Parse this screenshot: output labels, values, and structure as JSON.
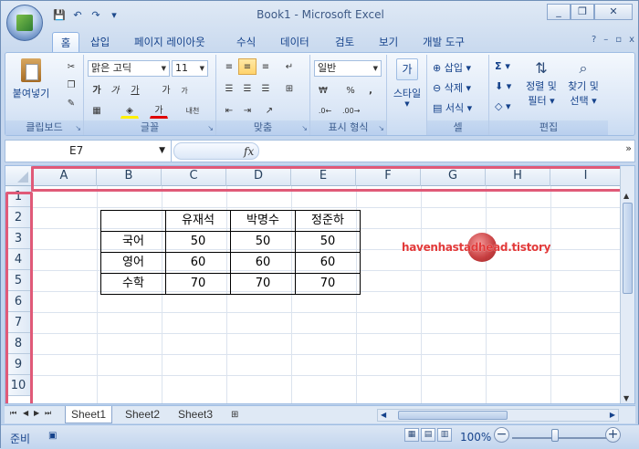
{
  "window": {
    "title": "Book1 - Microsoft Excel",
    "minimize": "_",
    "restore": "❐",
    "close": "✕"
  },
  "qat": {
    "save_icon": "💾",
    "undo_icon": "↶",
    "redo_icon": "↷",
    "more_icon": "▾"
  },
  "tabs": [
    {
      "label": "홈",
      "active": true
    },
    {
      "label": "삽입"
    },
    {
      "label": "페이지 레이아웃"
    },
    {
      "label": "수식"
    },
    {
      "label": "데이터"
    },
    {
      "label": "검토"
    },
    {
      "label": "보기"
    },
    {
      "label": "개발 도구"
    }
  ],
  "tab_icons": {
    "help": "?",
    "minimize": "–",
    "restore": "▫",
    "close": "x"
  },
  "ribbon": {
    "clipboard": {
      "label": "클립보드",
      "paste": "붙여넣기"
    },
    "font": {
      "label": "글꼴",
      "font_name": "맑은 고딕",
      "font_size": "11",
      "bold": "가",
      "italic": "가",
      "underline": "가",
      "grow": "가",
      "shrink": "가",
      "phonetic": "내천",
      "font_color_glyph": "가"
    },
    "alignment": {
      "label": "맞춤"
    },
    "number": {
      "label": "표시 형식",
      "format": "일반",
      "currency": "₩",
      "percent": "%",
      "comma": ","
    },
    "style": {
      "label": "스타일"
    },
    "cells": {
      "label": "셀",
      "insert": "삽입",
      "delete": "삭제",
      "format": "서식"
    },
    "editing": {
      "label": "편집",
      "sum": "Σ",
      "sort": "정렬 및",
      "sort2": "필터",
      "find": "찾기 및",
      "find2": "선택"
    }
  },
  "formula_bar": {
    "name_box": "E7",
    "fx": "fx",
    "formula": ""
  },
  "columns": [
    "A",
    "B",
    "C",
    "D",
    "E",
    "F",
    "G",
    "H",
    "I"
  ],
  "rows": [
    "1",
    "2",
    "3",
    "4",
    "5",
    "6",
    "7",
    "8",
    "9",
    "10"
  ],
  "table": {
    "header": [
      "",
      "유재석",
      "박명수",
      "정준하"
    ],
    "rows": [
      [
        "국어",
        "50",
        "50",
        "50"
      ],
      [
        "영어",
        "60",
        "60",
        "60"
      ],
      [
        "수학",
        "70",
        "70",
        "70"
      ]
    ]
  },
  "watermark": "havenhastadhead.tistory",
  "sheets": [
    {
      "name": "Sheet1",
      "active": true
    },
    {
      "name": "Sheet2"
    },
    {
      "name": "Sheet3"
    }
  ],
  "status": {
    "ready": "준비",
    "zoom": "100%",
    "zoom_minus": "−",
    "zoom_plus": "+"
  }
}
